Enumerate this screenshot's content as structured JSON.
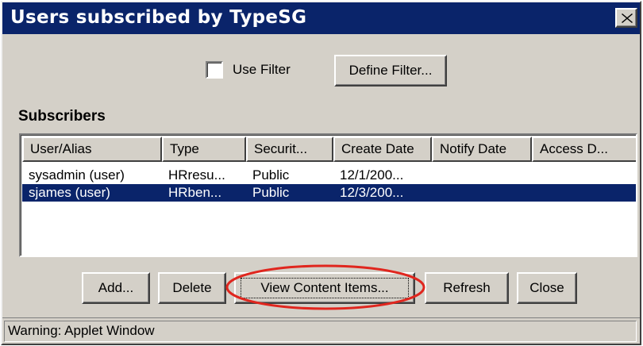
{
  "window": {
    "title": "Users subscribed by TypeSG"
  },
  "filter": {
    "use_filter_label": "Use Filter",
    "use_filter_checked": false,
    "define_filter_label": "Define Filter..."
  },
  "subscribers": {
    "section_label": "Subscribers",
    "columns": [
      "User/Alias",
      "Type",
      "Securit...",
      "Create Date",
      "Notify Date",
      "Access D..."
    ],
    "rows": [
      {
        "user": "sysadmin (user)",
        "type": "HRresu...",
        "security": "Public",
        "create_date": "12/1/200...",
        "notify_date": "",
        "access_date": "",
        "selected": false
      },
      {
        "user": "sjames (user)",
        "type": "HRben...",
        "security": "Public",
        "create_date": "12/3/200...",
        "notify_date": "",
        "access_date": "",
        "selected": true
      }
    ]
  },
  "buttons": {
    "add": "Add...",
    "delete": "Delete",
    "view_content_items": "View Content Items...",
    "refresh": "Refresh",
    "close": "Close"
  },
  "highlight": {
    "color": "#e0261e",
    "target": "view_content_items"
  },
  "status": {
    "text": "Warning: Applet Window"
  },
  "colors": {
    "titlebar": "#0a246a",
    "selection": "#0a246a",
    "face": "#d4d0c8"
  },
  "icons": {
    "close": "close-icon"
  }
}
